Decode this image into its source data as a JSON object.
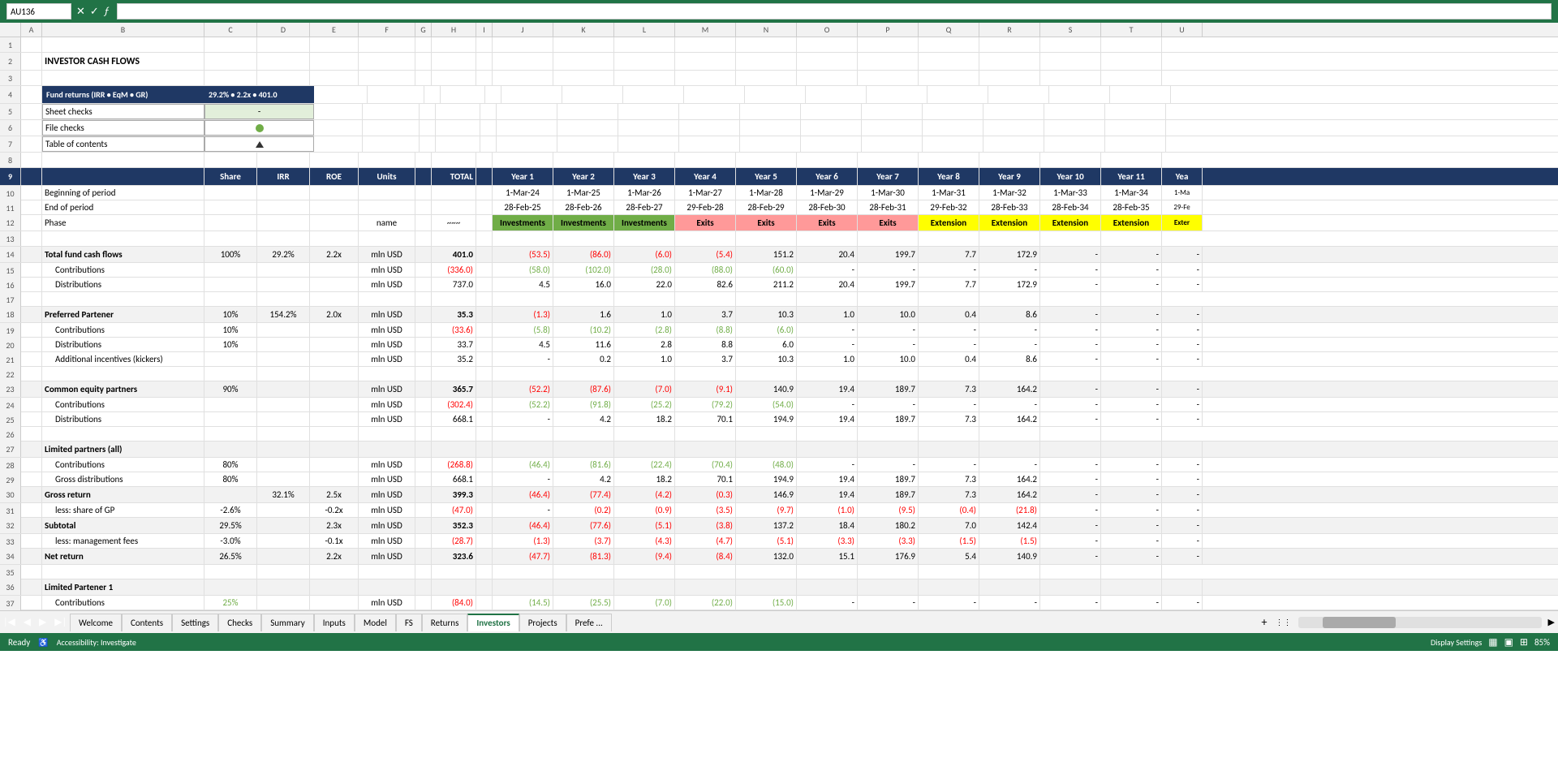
{
  "topbar": {
    "cell_ref": "AU136",
    "formula": "",
    "icons": [
      "✕",
      "✓",
      "ƒ"
    ]
  },
  "columns": [
    "A",
    "B",
    "C",
    "D",
    "E",
    "F",
    "G",
    "H",
    "I",
    "J",
    "K",
    "L",
    "M",
    "N",
    "O",
    "P",
    "Q",
    "R",
    "S",
    "T",
    "U"
  ],
  "header": {
    "title": "INVESTOR CASH FLOWS"
  },
  "summary_box": {
    "label": "Fund returns (IRR • EqM • GR)",
    "value": "29.2% • 2.2x • 401.0",
    "sheet_checks": "Sheet checks",
    "sheet_checks_val": "-",
    "file_checks": "File checks",
    "table_contents": "Table of contents"
  },
  "col_headers_row": {
    "share": "Share",
    "irr": "IRR",
    "roe": "ROE",
    "units": "Units",
    "total": "TOTAL",
    "year1": "Year 1",
    "year2": "Year 2",
    "year3": "Year 3",
    "year4": "Year 4",
    "year5": "Year 5",
    "year6": "Year 6",
    "year7": "Year 7",
    "year8": "Year 8",
    "year9": "Year 9",
    "year10": "Year 10",
    "year11": "Year 11"
  },
  "period_row": {
    "label_begin": "Beginning of period",
    "label_end": "End of period",
    "dates_begin": [
      "1-Mar-24",
      "1-Mar-25",
      "1-Mar-26",
      "1-Mar-27",
      "1-Mar-28",
      "1-Mar-29",
      "1-Mar-30",
      "1-Mar-31",
      "1-Mar-32",
      "1-Mar-33",
      "1-Mar-34",
      "1-Ma"
    ],
    "dates_end": [
      "28-Feb-25",
      "28-Feb-26",
      "28-Feb-27",
      "29-Feb-28",
      "28-Feb-29",
      "28-Feb-30",
      "28-Feb-31",
      "29-Feb-32",
      "28-Feb-33",
      "28-Feb-34",
      "28-Feb-35",
      "29-Fe"
    ]
  },
  "phase_row": {
    "label": "Phase",
    "unit": "name",
    "tilde": "~~~",
    "phases": [
      "Investments",
      "Investments",
      "Investments",
      "Exits",
      "Exits",
      "Exits",
      "Exits",
      "Extension",
      "Extension",
      "Extension",
      "Extension",
      "Exter"
    ]
  },
  "rows": [
    {
      "num": 14,
      "label": "Total fund cash flows",
      "share": "100%",
      "irr": "29.2%",
      "roe": "2.2x",
      "units": "mln USD",
      "total": "401.0",
      "values": [
        "(53.5)",
        "(86.0)",
        "(6.0)",
        "(5.4)",
        "151.2",
        "20.4",
        "199.7",
        "7.7",
        "172.9",
        "-",
        "-"
      ]
    },
    {
      "num": 15,
      "label": "Contributions",
      "share": "",
      "irr": "",
      "roe": "",
      "units": "mln USD",
      "total": "(336.0)",
      "values": [
        "(58.0)",
        "(102.0)",
        "(28.0)",
        "(88.0)",
        "(60.0)",
        "-",
        "-",
        "-",
        "-",
        "-",
        "-"
      ]
    },
    {
      "num": 16,
      "label": "Distributions",
      "share": "",
      "irr": "",
      "roe": "",
      "units": "mln USD",
      "total": "737.0",
      "values": [
        "4.5",
        "16.0",
        "22.0",
        "82.6",
        "211.2",
        "20.4",
        "199.7",
        "7.7",
        "172.9",
        "-",
        "-"
      ]
    },
    {
      "num": 18,
      "label": "Preferred Partener",
      "share": "10%",
      "irr": "154.2%",
      "roe": "2.0x",
      "units": "mln USD",
      "total": "35.3",
      "values": [
        "(1.3)",
        "1.6",
        "1.0",
        "3.7",
        "10.3",
        "1.0",
        "10.0",
        "0.4",
        "8.6",
        "-",
        "-"
      ]
    },
    {
      "num": 19,
      "label": "Contributions",
      "share": "10%",
      "irr": "",
      "roe": "",
      "units": "mln USD",
      "total": "(33.6)",
      "values": [
        "(5.8)",
        "(10.2)",
        "(2.8)",
        "(8.8)",
        "(6.0)",
        "-",
        "-",
        "-",
        "-",
        "-",
        "-"
      ]
    },
    {
      "num": 20,
      "label": "Distributions",
      "share": "10%",
      "irr": "",
      "roe": "",
      "units": "mln USD",
      "total": "33.7",
      "values": [
        "4.5",
        "11.6",
        "2.8",
        "8.8",
        "6.0",
        "-",
        "-",
        "-",
        "-",
        "-",
        "-"
      ]
    },
    {
      "num": 21,
      "label": "Additional incentives (kickers)",
      "share": "",
      "irr": "",
      "roe": "",
      "units": "mln USD",
      "total": "35.2",
      "values": [
        "-",
        "0.2",
        "1.0",
        "3.7",
        "10.3",
        "1.0",
        "10.0",
        "0.4",
        "8.6",
        "-",
        "-"
      ]
    },
    {
      "num": 23,
      "label": "Common equity partners",
      "share": "90%",
      "irr": "",
      "roe": "",
      "units": "mln USD",
      "total": "365.7",
      "values": [
        "(52.2)",
        "(87.6)",
        "(7.0)",
        "(9.1)",
        "140.9",
        "19.4",
        "189.7",
        "7.3",
        "164.2",
        "-",
        "-"
      ]
    },
    {
      "num": 24,
      "label": "Contributions",
      "share": "",
      "irr": "",
      "roe": "",
      "units": "mln USD",
      "total": "(302.4)",
      "values": [
        "(52.2)",
        "(91.8)",
        "(25.2)",
        "(79.2)",
        "(54.0)",
        "-",
        "-",
        "-",
        "-",
        "-",
        "-"
      ]
    },
    {
      "num": 25,
      "label": "Distributions",
      "share": "",
      "irr": "",
      "roe": "",
      "units": "mln USD",
      "total": "668.1",
      "values": [
        "-",
        "4.2",
        "18.2",
        "70.1",
        "194.9",
        "19.4",
        "189.7",
        "7.3",
        "164.2",
        "-",
        "-"
      ]
    },
    {
      "num": 27,
      "label": "Limited partners (all)",
      "share": "",
      "irr": "",
      "roe": "",
      "units": "",
      "total": "",
      "values": []
    },
    {
      "num": 28,
      "label": "Contributions",
      "share": "80%",
      "irr": "",
      "roe": "",
      "units": "mln USD",
      "total": "(268.8)",
      "values": [
        "(46.4)",
        "(81.6)",
        "(22.4)",
        "(70.4)",
        "(48.0)",
        "-",
        "-",
        "-",
        "-",
        "-",
        "-"
      ]
    },
    {
      "num": 29,
      "label": "Gross distributions",
      "share": "80%",
      "irr": "",
      "roe": "",
      "units": "mln USD",
      "total": "668.1",
      "values": [
        "-",
        "4.2",
        "18.2",
        "70.1",
        "194.9",
        "19.4",
        "189.7",
        "7.3",
        "164.2",
        "-",
        "-"
      ]
    },
    {
      "num": 30,
      "label": "Gross return",
      "share": "",
      "irr": "32.1%",
      "roe": "2.5x",
      "units": "mln USD",
      "total": "399.3",
      "values": [
        "(46.4)",
        "(77.4)",
        "(4.2)",
        "(0.3)",
        "146.9",
        "19.4",
        "189.7",
        "7.3",
        "164.2",
        "-",
        "-"
      ]
    },
    {
      "num": 31,
      "label": "less: share of GP",
      "share": "-2.6%",
      "irr": "",
      "roe": "-0.2x",
      "units": "mln USD",
      "total": "(47.0)",
      "values": [
        "-",
        "(0.2)",
        "(0.9)",
        "(3.5)",
        "(9.7)",
        "(1.0)",
        "(9.5)",
        "(0.4)",
        "(21.8)",
        "-",
        "-"
      ]
    },
    {
      "num": 32,
      "label": "Subtotal",
      "share": "29.5%",
      "irr": "",
      "roe": "2.3x",
      "units": "mln USD",
      "total": "352.3",
      "values": [
        "(46.4)",
        "(77.6)",
        "(5.1)",
        "(3.8)",
        "137.2",
        "18.4",
        "180.2",
        "7.0",
        "142.4",
        "-",
        "-"
      ]
    },
    {
      "num": 33,
      "label": "less: management fees",
      "share": "-3.0%",
      "irr": "",
      "roe": "-0.1x",
      "units": "mln USD",
      "total": "(28.7)",
      "values": [
        "(1.3)",
        "(3.7)",
        "(4.3)",
        "(4.7)",
        "(5.1)",
        "(3.3)",
        "(3.3)",
        "(1.5)",
        "(1.5)",
        "-",
        "-"
      ]
    },
    {
      "num": 34,
      "label": "Net return",
      "share": "26.5%",
      "irr": "",
      "roe": "2.2x",
      "units": "mln USD",
      "total": "323.6",
      "values": [
        "(47.7)",
        "(81.3)",
        "(9.4)",
        "(8.4)",
        "132.0",
        "15.1",
        "176.9",
        "5.4",
        "140.9",
        "-",
        "-"
      ]
    },
    {
      "num": 36,
      "label": "Limited Partener 1",
      "share": "",
      "irr": "",
      "roe": "",
      "units": "",
      "total": "",
      "values": []
    },
    {
      "num": 37,
      "label": "Contributions",
      "share": "25%",
      "irr": "",
      "roe": "",
      "units": "mln USD",
      "total": "(84.0)",
      "values": [
        "(14.5)",
        "(25.5)",
        "(7.0)",
        "(22.0)",
        "(15.0)",
        "-",
        "-",
        "-",
        "-",
        "-",
        "-"
      ]
    }
  ],
  "tabs": [
    {
      "label": "Welcome",
      "active": false
    },
    {
      "label": "Contents",
      "active": false
    },
    {
      "label": "Settings",
      "active": false
    },
    {
      "label": "Checks",
      "active": false
    },
    {
      "label": "Summary",
      "active": false
    },
    {
      "label": "Inputs",
      "active": false
    },
    {
      "label": "Model",
      "active": false
    },
    {
      "label": "FS",
      "active": false
    },
    {
      "label": "Returns",
      "active": false
    },
    {
      "label": "Investors",
      "active": true
    },
    {
      "label": "Projects",
      "active": false
    },
    {
      "label": "Prefe ...",
      "active": false
    }
  ],
  "statusbar": {
    "ready": "Ready",
    "accessibility": "Accessibility: Investigate",
    "display_settings": "Display Settings",
    "zoom": "85%"
  }
}
